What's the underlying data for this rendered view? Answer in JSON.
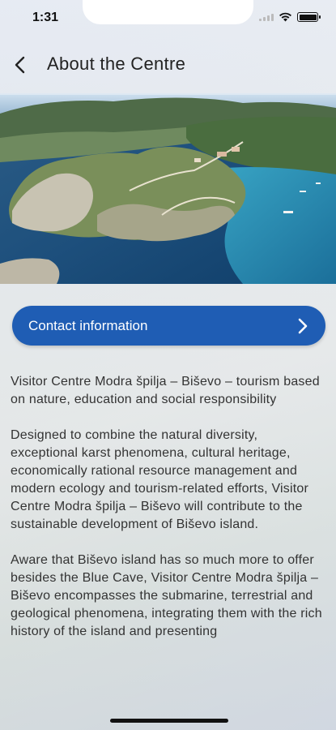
{
  "status_bar": {
    "time": "1:31"
  },
  "header": {
    "title": "About the Centre"
  },
  "hero": {
    "icon": "aerial-island-photo"
  },
  "contact": {
    "label": "Contact information",
    "color": "#1f5db4"
  },
  "content": {
    "paragraphs": [
      "Visitor Centre Modra špilja – Biševo – tourism based on nature, education and social responsibility",
      "Designed to combine the natural diversity, exceptional karst phenomena, cultural heritage, economically rational resource management and modern ecology and tourism-related efforts, Visitor Centre Modra špilja – Biševo will contribute to the sustainable development of Biševo island.",
      "Aware that Biševo island has so much more to offer besides the Blue Cave, Visitor Centre Modra špilja – Biševo encompasses the submarine, terrestrial and geological phenomena, integrating them with the rich history of the island and presenting"
    ]
  }
}
